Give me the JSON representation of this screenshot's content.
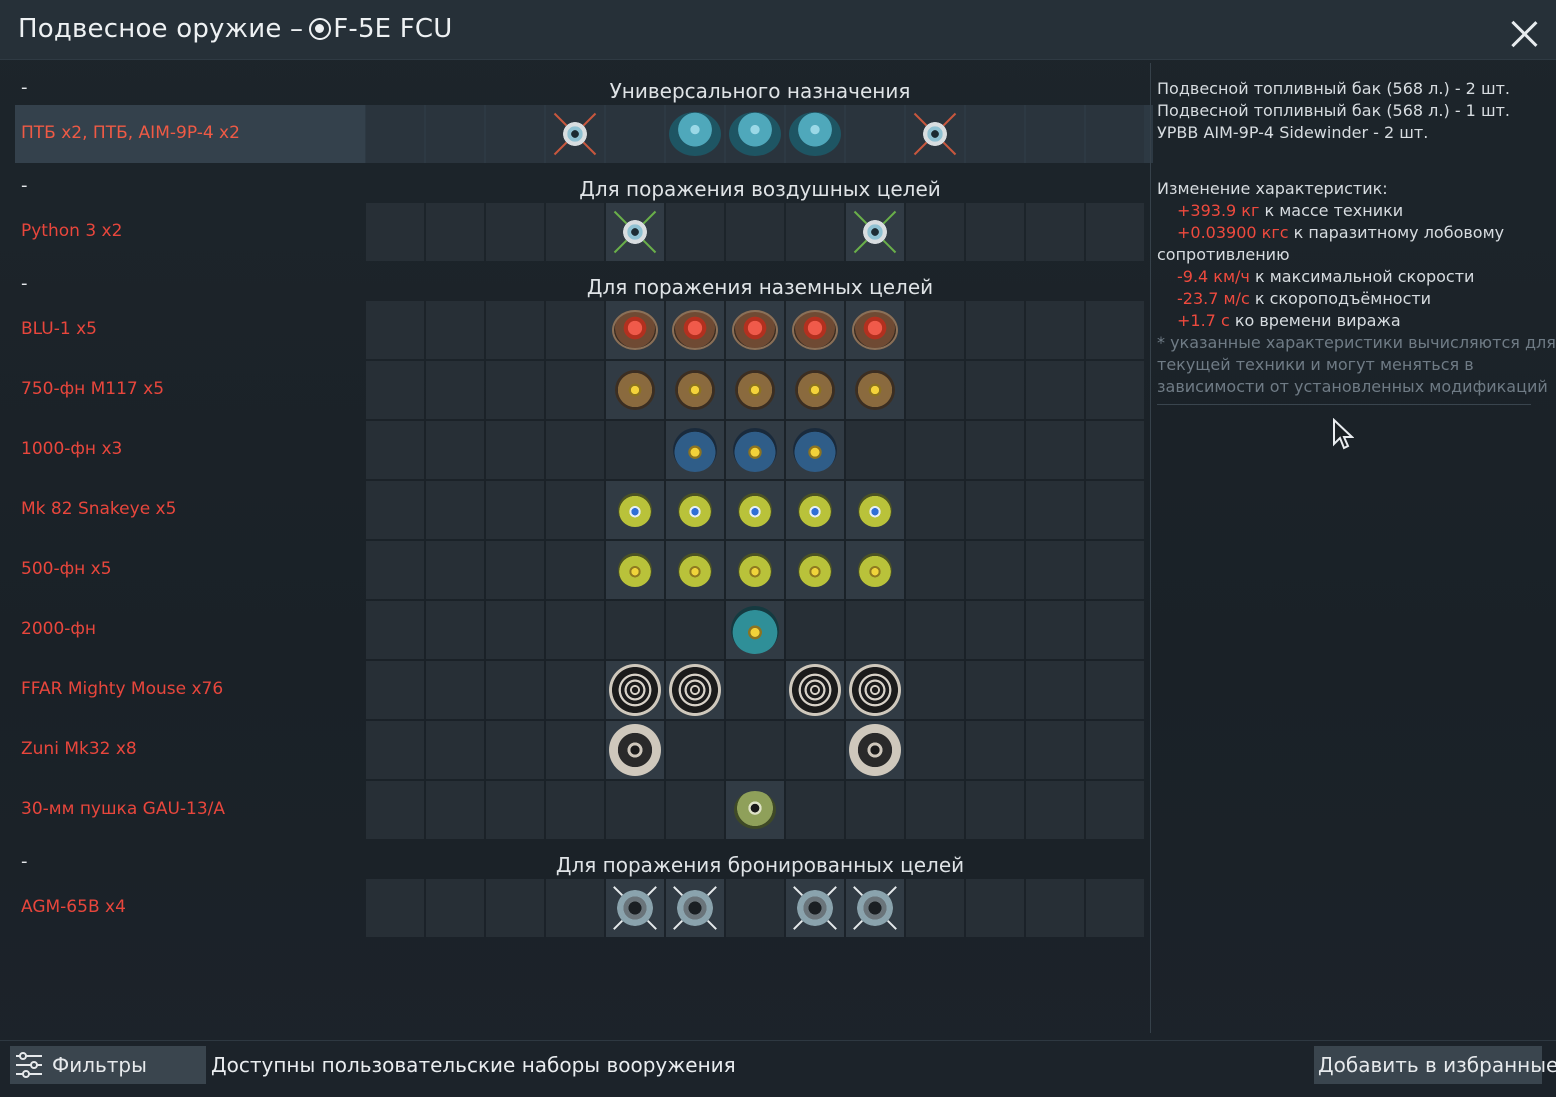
{
  "window": {
    "title_prefix": "Подвесное оружие – ",
    "title_vehicle": "F-5E FCU",
    "close_icon": "close-icon"
  },
  "categories": [
    {
      "dash": "-",
      "title": "Универсального назначения"
    },
    {
      "dash": "-",
      "title": "Для поражения воздушных целей"
    },
    {
      "dash": "-",
      "title": "Для поражения наземных целей"
    },
    {
      "dash": "-",
      "title": "Для поражения бронированных целей"
    }
  ],
  "presets": [
    {
      "label": "ПТБ x2,  ПТБ,  AIM-9P-4 x2",
      "selected": true,
      "slots": [
        "",
        "",
        "",
        "missile-red",
        "",
        "tank",
        "tank",
        "tank",
        "",
        "missile-red",
        "",
        "",
        ""
      ]
    },
    {
      "label": "Python 3 x2",
      "selected": false,
      "slots": [
        "",
        "",
        "",
        "",
        "missile-green",
        "",
        "",
        "",
        "missile-green",
        "",
        "",
        "",
        ""
      ]
    },
    {
      "label": "BLU-1 x5",
      "selected": false,
      "slots": [
        "",
        "",
        "",
        "",
        "redbomb",
        "redbomb",
        "redbomb",
        "redbomb",
        "redbomb",
        "",
        "",
        "",
        ""
      ]
    },
    {
      "label": "750-фн M117 x5",
      "selected": false,
      "slots": [
        "",
        "",
        "",
        "",
        "brownbomb",
        "brownbomb",
        "brownbomb",
        "brownbomb",
        "brownbomb",
        "",
        "",
        "",
        ""
      ]
    },
    {
      "label": "1000-фн x3",
      "selected": false,
      "slots": [
        "",
        "",
        "",
        "",
        "",
        "bluebomb",
        "bluebomb",
        "bluebomb",
        "",
        "",
        "",
        "",
        ""
      ]
    },
    {
      "label": "Mk 82 Snakeye x5",
      "selected": false,
      "slots": [
        "",
        "",
        "",
        "",
        "yellowbomb-b",
        "yellowbomb-b",
        "yellowbomb-b",
        "yellowbomb-b",
        "yellowbomb-b",
        "",
        "",
        "",
        ""
      ]
    },
    {
      "label": "500-фн x5",
      "selected": false,
      "slots": [
        "",
        "",
        "",
        "",
        "yellowbomb-y",
        "yellowbomb-y",
        "yellowbomb-y",
        "yellowbomb-y",
        "yellowbomb-y",
        "",
        "",
        "",
        ""
      ]
    },
    {
      "label": "2000-фн",
      "selected": false,
      "slots": [
        "",
        "",
        "",
        "",
        "",
        "",
        "tealbomb",
        "",
        "",
        "",
        "",
        "",
        ""
      ]
    },
    {
      "label": "FFAR Mighty Mouse x76",
      "selected": false,
      "slots": [
        "",
        "",
        "",
        "",
        "rocket76",
        "rocket76",
        "",
        "rocket76",
        "rocket76",
        "",
        "",
        "",
        ""
      ]
    },
    {
      "label": "Zuni Mk32 x8",
      "selected": false,
      "slots": [
        "",
        "",
        "",
        "",
        "rocket8",
        "",
        "",
        "",
        "rocket8",
        "",
        "",
        "",
        ""
      ]
    },
    {
      "label": "30-мм пушка GAU-13/A",
      "selected": false,
      "slots": [
        "",
        "",
        "",
        "",
        "",
        "",
        "gun",
        "",
        "",
        "",
        "",
        "",
        ""
      ]
    },
    {
      "label": "AGM-65B x4",
      "selected": false,
      "slots": [
        "",
        "",
        "",
        "",
        "agm",
        "agm",
        "",
        "agm",
        "agm",
        "",
        "",
        "",
        ""
      ]
    }
  ],
  "details": {
    "items": [
      "Подвесной топливный бак (568 л.) - 2 шт.",
      "Подвесной топливный бак (568 л.) - 1 шт.",
      "УРВВ AIM-9P-4 Sidewinder - 2 шт."
    ],
    "changes_title": "Изменение характеристик:",
    "stats": [
      {
        "value": "+393.9 кг",
        "text": " к массе техники"
      },
      {
        "value": "+0.03900 кгс",
        "text": " к паразитному лобовому"
      }
    ],
    "stat_wrap": "сопротивлению",
    "stats2": [
      {
        "value": "-9.4 км/ч",
        "text": " к максимальной скорости"
      },
      {
        "value": "-23.7 м/с",
        "text": " к скороподъёмности"
      },
      {
        "value": "+1.7 с",
        "text": " ко времени виража"
      }
    ],
    "note": [
      "* указанные характеристики вычисляются для",
      "текущей техники и могут меняться в",
      "зависимости от установленных модификаций"
    ]
  },
  "footer": {
    "filters_label": "Фильтры",
    "custom_sets_text": "Доступны пользовательские наборы вооружения",
    "favorite_label": "Добавить в избранные"
  }
}
